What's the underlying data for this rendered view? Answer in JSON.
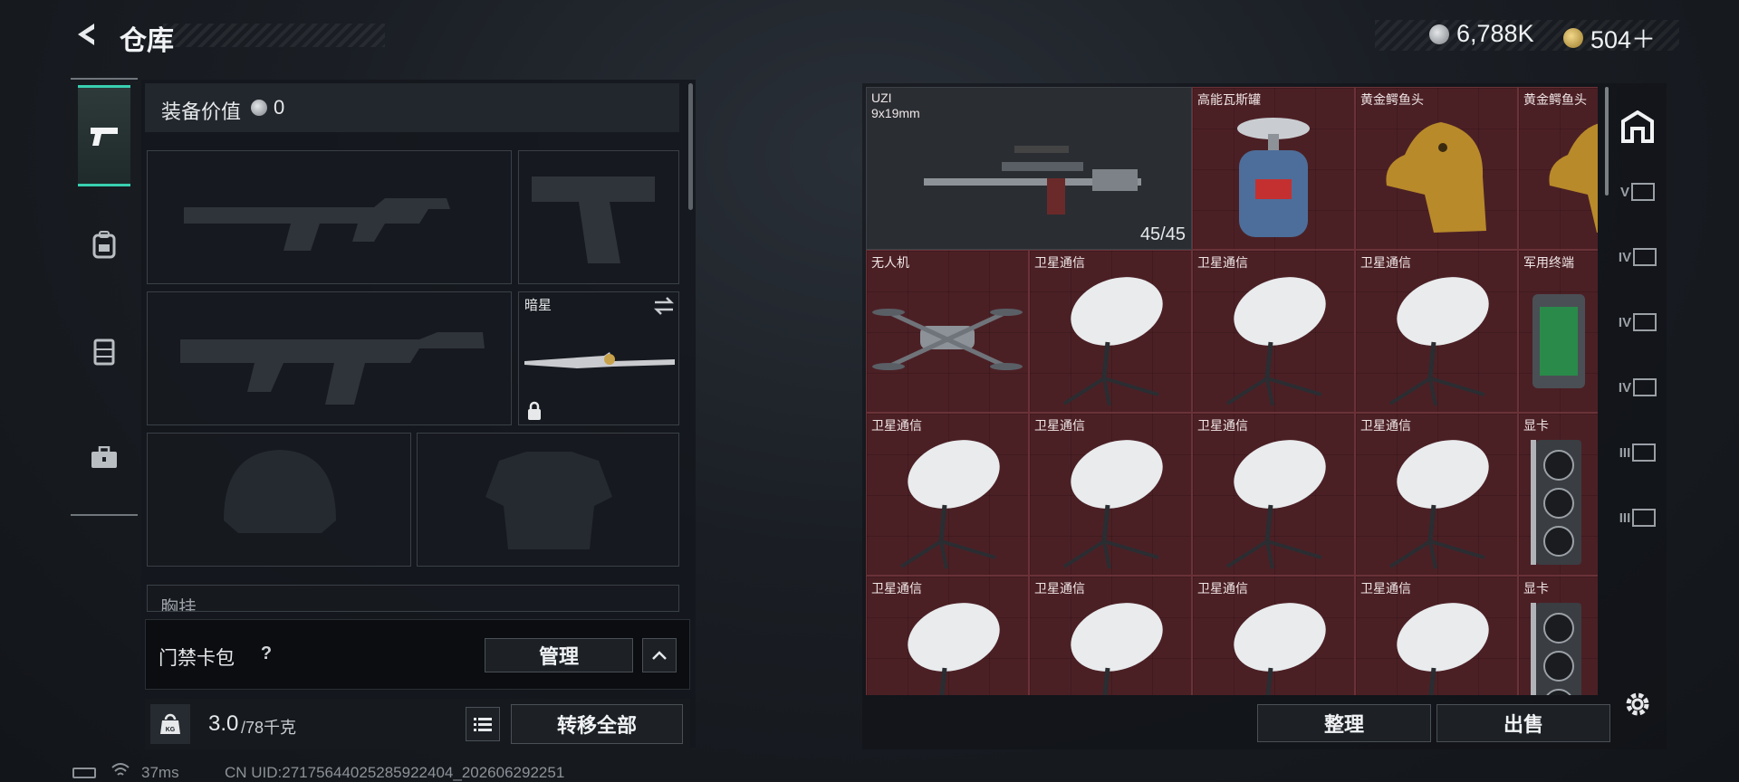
{
  "header": {
    "title": "仓库",
    "silver": "6,788K",
    "gold": "504＋"
  },
  "loadout": {
    "equip_value_label": "装备价值",
    "equip_value": "0",
    "secondary_slot": {
      "name": "暗星"
    },
    "chest_rig_partial": "胸挂",
    "access_card": {
      "label": "门禁卡包",
      "help": "?",
      "manage": "管理"
    },
    "weight": {
      "current": "3.0",
      "capacity": "/78千克",
      "icon_label": "KG"
    },
    "transfer_all": "转移全部"
  },
  "stash": {
    "items": [
      {
        "name": "UZI",
        "sub": "9x19mm",
        "ammo": "45/45",
        "kind": "weapon"
      },
      {
        "name": "高能瓦斯罐",
        "kind": "gas"
      },
      {
        "name": "黄金鳄鱼头",
        "kind": "croc"
      },
      {
        "name": "黄金鳄鱼头",
        "kind": "croc"
      },
      {
        "name": "无人机",
        "kind": "drone"
      },
      {
        "name": "卫星通信",
        "kind": "dish"
      },
      {
        "name": "卫星通信",
        "kind": "dish"
      },
      {
        "name": "卫星通信",
        "kind": "dish"
      },
      {
        "name": "军用终端",
        "kind": "terminal"
      },
      {
        "name": "卫星通信",
        "kind": "dish"
      },
      {
        "name": "卫星通信",
        "kind": "dish"
      },
      {
        "name": "卫星通信",
        "kind": "dish"
      },
      {
        "name": "卫星通信",
        "kind": "dish"
      },
      {
        "name": "显卡",
        "kind": "gpu"
      },
      {
        "name": "卫星通信",
        "kind": "dish"
      },
      {
        "name": "卫星通信",
        "kind": "dish"
      },
      {
        "name": "卫星通信",
        "kind": "dish"
      },
      {
        "name": "卫星通信",
        "kind": "dish"
      },
      {
        "name": "显卡",
        "kind": "gpu"
      }
    ],
    "sort": "整理",
    "sell": "出售",
    "filters": [
      "home",
      "V",
      "IV",
      "IV",
      "IV",
      "III",
      "III"
    ]
  },
  "status": {
    "ping": "37ms",
    "uid": "CN UID:27175644025285922404_202606292251"
  },
  "colors": {
    "accent": "#38d0b0",
    "red_cell": "#4b2025",
    "panel": "#14181d"
  }
}
